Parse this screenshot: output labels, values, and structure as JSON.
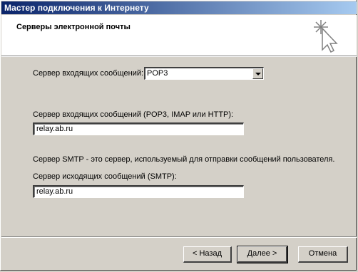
{
  "window": {
    "title": "Мастер подключения к Интернету"
  },
  "header": {
    "title": "Серверы электронной почты",
    "icon": "wizard-sparkle-cursor-icon"
  },
  "form": {
    "incoming_type_label": "Сервер входящих сообщений:",
    "incoming_type_value": "POP3",
    "incoming_server_label": "Сервер входящих сообщений (POP3, IMAP или HTTP):",
    "incoming_server_value": "relay.ab.ru",
    "smtp_note": "Сервер SMTP - это сервер, используемый для отправки сообщений  пользователя.",
    "outgoing_server_label": "Сервер исходящих сообщений (SMTP):",
    "outgoing_server_value": "relay.ab.ru"
  },
  "buttons": {
    "back": "< Назад",
    "next": "Далее >",
    "cancel": "Отмена"
  }
}
